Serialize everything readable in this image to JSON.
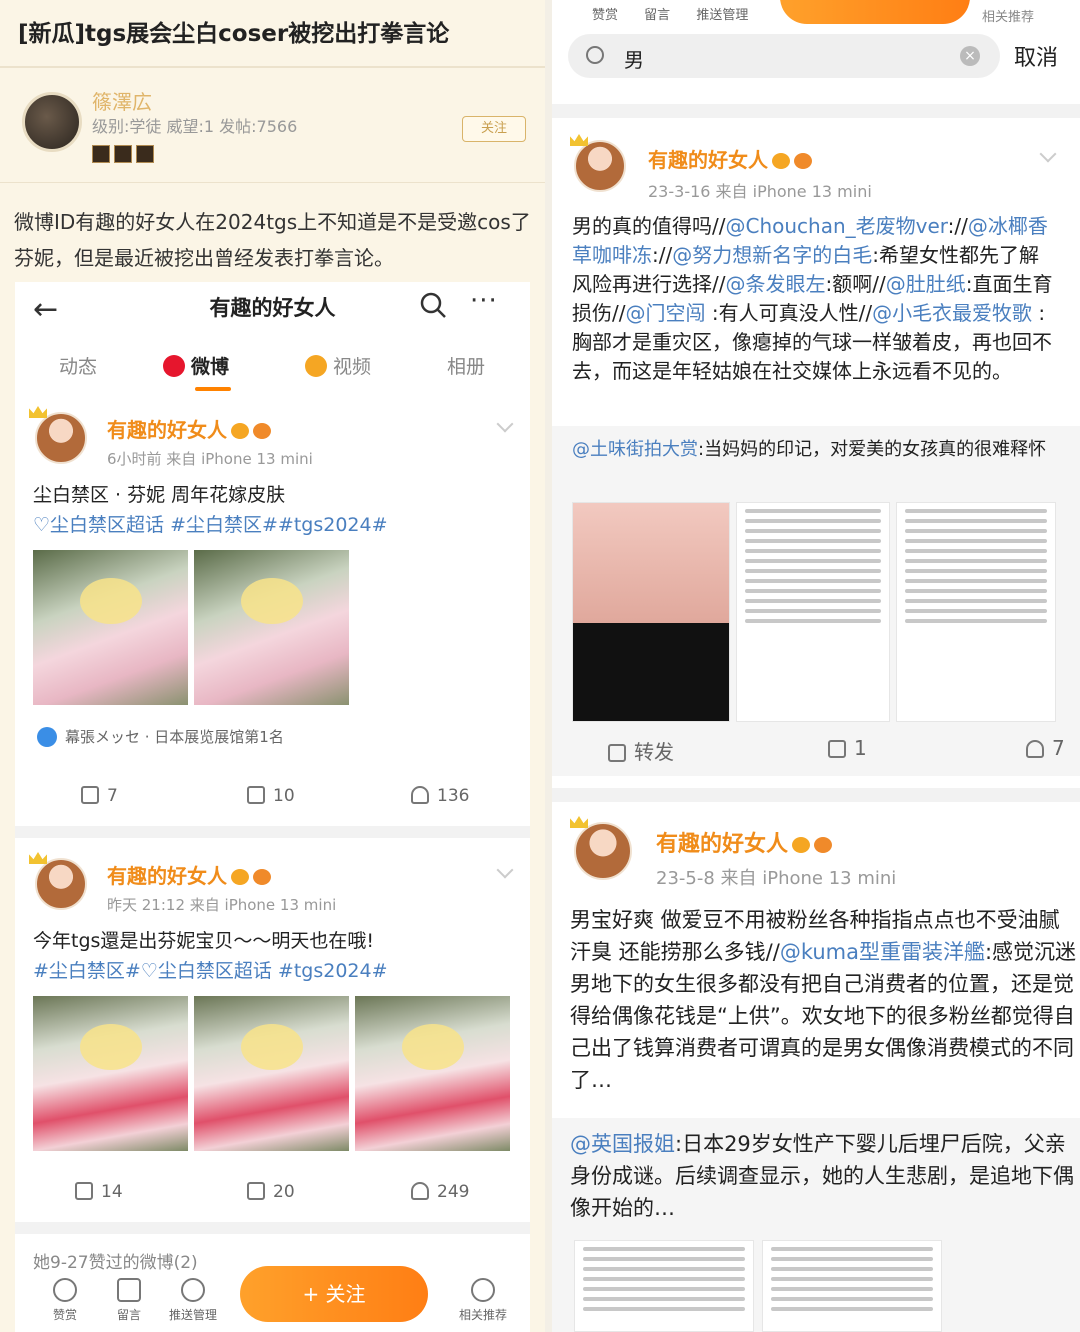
{
  "left": {
    "forum_title": "[新瓜]tgs展会尘白coser被挖出打拳言论",
    "poster": {
      "name": "篠澤広",
      "info": "级别:学徒 威望:1 发帖:7566",
      "follow_label": "关注"
    },
    "intro": "微博ID有趣的好女人在2024tgs上不知道是不是受邀cos了芬妮，但是最近被挖出曾经发表打拳言论。",
    "weibo": {
      "back_icon": "back-arrow-icon",
      "title": "有趣的好女人",
      "more": "···",
      "tabs": [
        "动态",
        "微博",
        "视频",
        "相册"
      ],
      "active_tab": "微博",
      "accent_color": "#ff8200",
      "posts": [
        {
          "user": "有趣的好女人",
          "meta": "6小时前  来自 iPhone 13 mini",
          "text": "尘白禁区 · 芬妮 周年花嫁皮肤",
          "tags": "♡尘白禁区超话 #尘白禁区##tgs2024#",
          "location": "幕張メッセ · 日本展览展馆第1名",
          "reposts": "7",
          "comments": "10",
          "likes": "136"
        },
        {
          "user": "有趣的好女人",
          "meta": "昨天 21:12  来自 iPhone 13 mini",
          "text": "今年tgs還是出芬妮宝贝～～明天也在哦!",
          "tags": "#尘白禁区#♡尘白禁区超话 #tgs2024#",
          "reposts": "14",
          "comments": "20",
          "likes": "249"
        }
      ],
      "liked_label": "她9-27赞过的微博(2)",
      "bottom_bar": {
        "items": [
          "赞赏",
          "留言",
          "推送管理"
        ],
        "follow": "+ 关注",
        "right": "相关推荐"
      }
    }
  },
  "right": {
    "top_labels": [
      "赞赏",
      "留言",
      "推送管理"
    ],
    "top_right": "相关推荐",
    "search": {
      "value": "男",
      "cancel": "取消"
    },
    "posts": [
      {
        "user": "有趣的好女人",
        "meta": "23-3-16  来自 iPhone 13 mini",
        "text_plain_1": "男的真的值得吗//",
        "link_1": "@Chouchan_老废物ver",
        "text_plain_2": "://",
        "link_2": "@冰椰香草咖啡冻",
        "text_plain_3": "://",
        "link_3": "@努力想新名字的白毛",
        "text_plain_4": ":希望女性都先了解风险再进行选择//",
        "link_4": "@条发眼左",
        "text_plain_5": ":额啊//",
        "link_5": "@肚肚纸",
        "text_plain_6": ":直面生育损伤//",
        "link_6": "@门空闯",
        "text_plain_7": " :有人可真没人性//",
        "link_7": "@小毛衣最爱牧歌",
        "text_plain_8": " :胸部才是重灾区，像瘪掉的气球一样皱着皮，再也回不去，而这是年轻姑娘在社交媒体上永远看不见的。",
        "repost_link": "@土味街拍大赏",
        "repost_text": ":当妈妈的印记，对爱美的女孩真的很难释怀",
        "reposts_label": "转发",
        "comments": "1",
        "likes": "7"
      },
      {
        "user": "有趣的好女人",
        "meta": "23-5-8  来自 iPhone 13 mini",
        "text_plain_1": "男宝好爽 做爱豆不用被粉丝各种指指点点也不受油腻汗臭 还能捞那么多钱//",
        "link_1": "@kuma型重雷装洋艦",
        "text_plain_2": ":感觉沉迷男地下的女生很多都没有把自己消费者的位置，还是觉得给偶像花钱是“上供”。欢女地下的很多粉丝都觉得自己出了钱算消费者可谓真的是男女偶像消费模式的不同了…",
        "repost_link": "@英国报姐",
        "repost_text": ":日本29岁女性产下婴儿后埋尸后院，父亲身份成谜。后续调查显示，她的人生悲剧，是追地下偶像开始的…"
      }
    ]
  }
}
